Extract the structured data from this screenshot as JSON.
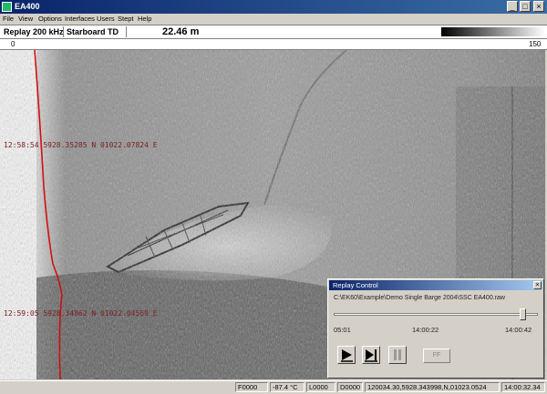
{
  "window": {
    "title": "EA400",
    "min_glyph": "_",
    "max_glyph": "□",
    "close_glyph": "×"
  },
  "menu": [
    "File",
    "View",
    "Options",
    "Interfaces",
    "Users",
    "Stept",
    "Help"
  ],
  "infobar": {
    "mode": "Replay 200 kHz",
    "transducer": "Starboard TD",
    "range": "22.46 m"
  },
  "ruler": {
    "left": "0",
    "right": "150"
  },
  "sonar": {
    "colors": {
      "track_line": "#d01010",
      "coord_text": "#7a2020"
    },
    "annotations": [
      "12:58:54 5928.35285 N 01022.07824 E",
      "12:59:05 5928.34862 N 01022.04569 E"
    ]
  },
  "replay": {
    "title": "Replay Control",
    "file": "C:\\EK60\\Example\\Demo Single Barge 2004\\SSC EA400.raw",
    "progress": 0.94,
    "times": [
      "05:01",
      "14:00:22",
      "14:00:42"
    ],
    "buttons": [
      {
        "name": "play",
        "icon": "play-icon",
        "enabled": true
      },
      {
        "name": "step",
        "icon": "step-forward-icon",
        "enabled": true
      },
      {
        "name": "pause",
        "icon": "pause-icon",
        "enabled": false
      }
    ],
    "ff_label": "FF"
  },
  "statusbar": {
    "cells": [
      "F0000",
      "-87.4 °C",
      "L0000",
      "D0000",
      "120034.30,5928.343998,N,01023.0524",
      "14:00:32.34"
    ]
  }
}
